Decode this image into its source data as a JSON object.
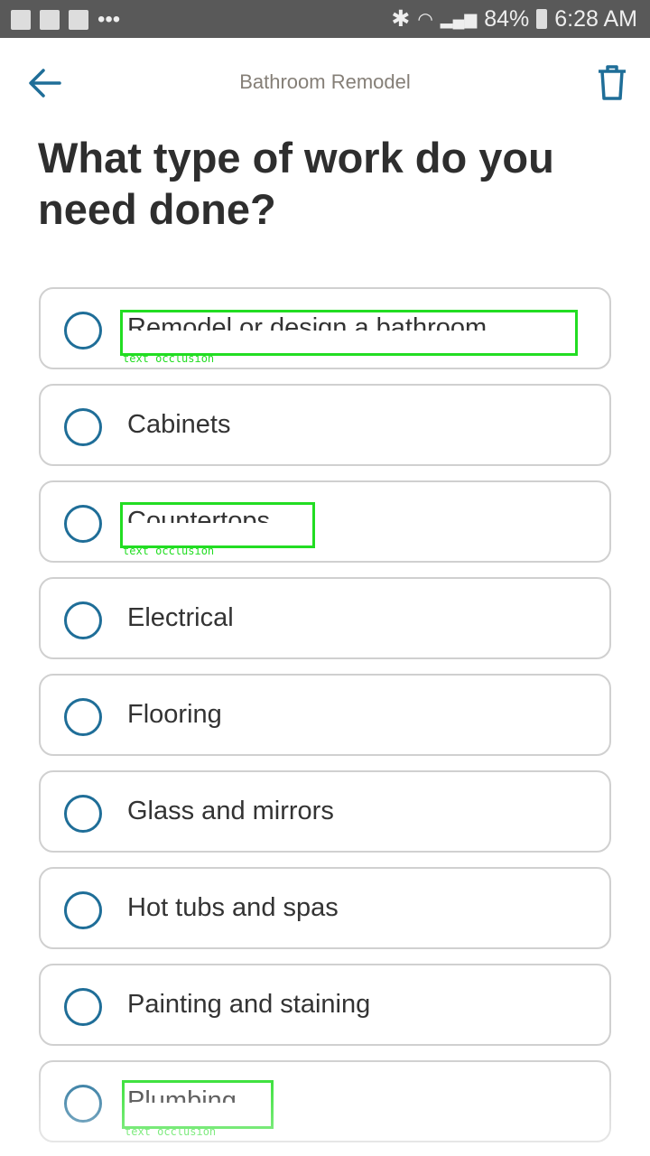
{
  "status_bar": {
    "battery": "84%",
    "time": "6:28 AM",
    "more": "•••"
  },
  "header": {
    "title": "Bathroom Remodel"
  },
  "question": "What type of work do you need done?",
  "options": [
    {
      "label": "Remodel or design a bathroom"
    },
    {
      "label": "Cabinets"
    },
    {
      "label": "Countertops"
    },
    {
      "label": "Electrical"
    },
    {
      "label": "Flooring"
    },
    {
      "label": "Glass and mirrors"
    },
    {
      "label": "Hot tubs and spas"
    },
    {
      "label": "Painting and staining"
    },
    {
      "label": "Plumbing"
    }
  ],
  "annotations": {
    "occlusion_label": "text occlusion"
  },
  "colors": {
    "accent": "#1f6e98",
    "text": "#333333",
    "border": "#d0d0d0",
    "annotation": "#22dd22"
  }
}
